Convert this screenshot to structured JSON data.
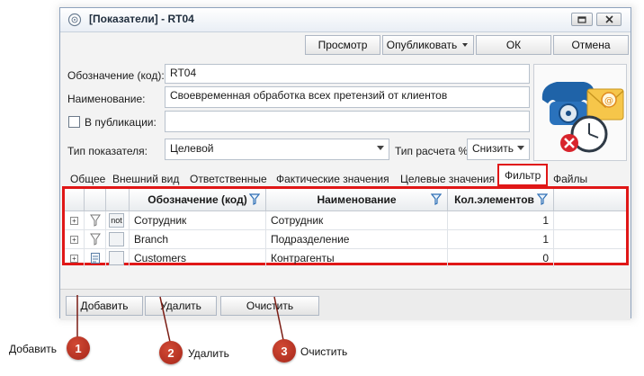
{
  "window": {
    "title": "[Показатели] - RT04"
  },
  "toolbar": {
    "preview_label": "Просмотр",
    "publish_label": "Опубликовать",
    "ok_label": "ОК",
    "cancel_label": "Отмена"
  },
  "form": {
    "code_label": "Обозначение (код):",
    "code_value": "RT04",
    "name_label": "Наименование:",
    "name_value": "Своевременная обработка всех претензий от клиентов",
    "publication_label": "В публикации:",
    "publication_value": "",
    "indicator_type_label": "Тип показателя:",
    "indicator_type_value": "Целевой",
    "calc_type_label": "Тип расчета %",
    "calc_type_value": "Снизить"
  },
  "tabs": [
    {
      "label": "Общее"
    },
    {
      "label": "Внешний вид"
    },
    {
      "label": "Ответственные"
    },
    {
      "label": "Фактические значения"
    },
    {
      "label": "Целевые значения"
    },
    {
      "label": "Фильтр"
    },
    {
      "label": "Файлы"
    }
  ],
  "active_tab": "Фильтр",
  "grid": {
    "columns": [
      "Обозначение (код)",
      "Наименование",
      "Кол.элементов"
    ],
    "rows": [
      {
        "expander": "+",
        "not": "not",
        "code": "Сотрудник",
        "name": "Сотрудник",
        "count": "1"
      },
      {
        "expander": "+",
        "not": "",
        "code": "Branch",
        "name": "Подразделение",
        "count": "1"
      },
      {
        "expander": "+",
        "not": "",
        "code": "Customers",
        "name": "Контрагенты",
        "count": "0"
      }
    ]
  },
  "bottom": {
    "add_label": "Добавить",
    "delete_label": "Удалить",
    "clear_label": "Очистить"
  },
  "callouts": [
    {
      "number": "1",
      "label": "Добавить"
    },
    {
      "number": "2",
      "label": "Удалить"
    },
    {
      "number": "3",
      "label": "Очистить"
    }
  ],
  "colors": {
    "highlight": "#e01717",
    "badge": "#b3301f"
  }
}
